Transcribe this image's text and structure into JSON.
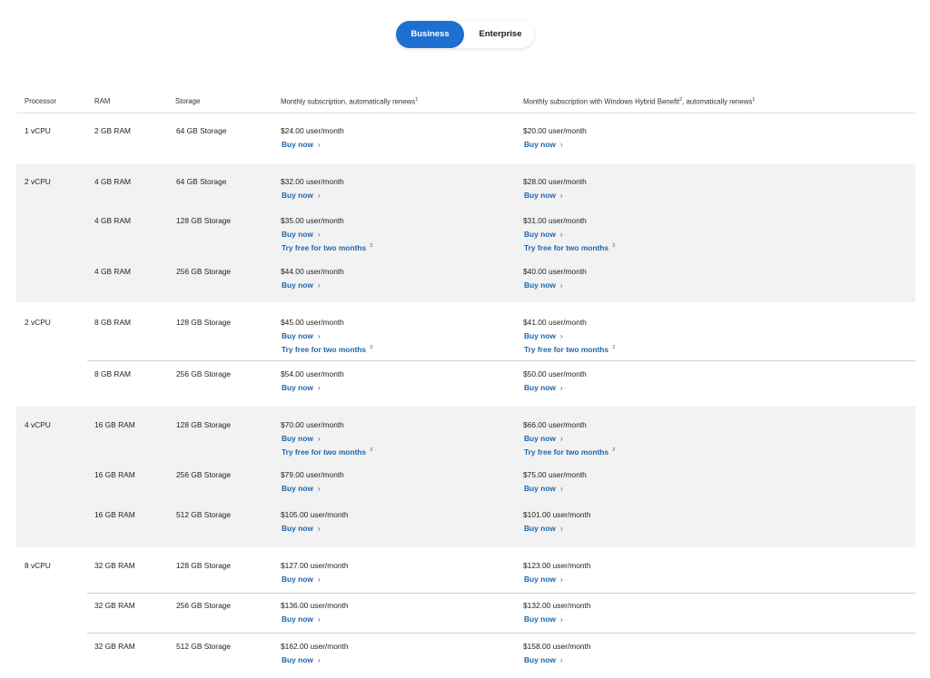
{
  "toggle": {
    "business": "Business",
    "enterprise": "Enterprise",
    "active_color": "#1f6fd0"
  },
  "table": {
    "headers": {
      "processor": "Processor",
      "ram": "RAM",
      "storage": "Storage",
      "monthly": "Monthly subscription, automatically renews",
      "monthly_sup": "1",
      "hybrid_pre": "Monthly subscription with ",
      "hybrid_bold": "Windows Hybrid Benefit",
      "hybrid_sup1": "2",
      "hybrid_post": ", automatically renews",
      "hybrid_sup2": "1"
    },
    "links": {
      "buy": "Buy now",
      "try": "Try free for two months",
      "try_sup": "3",
      "link_color": "#2266aa"
    },
    "rows": [
      {
        "processor": "1 vCPU",
        "ram": "2 GB RAM",
        "storage": "64 GB Storage",
        "price": "$24.00 user/month",
        "hybrid": "$20.00 user/month",
        "try": false
      },
      {
        "processor": "2 vCPU",
        "ram": "4 GB RAM",
        "storage": "64 GB Storage",
        "price": "$32.00 user/month",
        "hybrid": "$28.00 user/month",
        "try": false
      },
      {
        "processor": "",
        "ram": "4 GB RAM",
        "storage": "128 GB Storage",
        "price": "$35.00 user/month",
        "hybrid": "$31.00 user/month",
        "try": true
      },
      {
        "processor": "",
        "ram": "4 GB RAM",
        "storage": "256 GB Storage",
        "price": "$44.00 user/month",
        "hybrid": "$40.00 user/month",
        "try": false
      },
      {
        "processor": "2 vCPU",
        "ram": "8 GB RAM",
        "storage": "128 GB Storage",
        "price": "$45.00 user/month",
        "hybrid": "$41.00 user/month",
        "try": true
      },
      {
        "processor": "",
        "ram": "8 GB RAM",
        "storage": "256 GB Storage",
        "price": "$54.00 user/month",
        "hybrid": "$50.00 user/month",
        "try": false
      },
      {
        "processor": "4 vCPU",
        "ram": "16 GB RAM",
        "storage": "128 GB Storage",
        "price": "$70.00 user/month",
        "hybrid": "$66.00 user/month",
        "try": true
      },
      {
        "processor": "",
        "ram": "16 GB RAM",
        "storage": "256 GB Storage",
        "price": "$79.00 user/month",
        "hybrid": "$75.00 user/month",
        "try": false
      },
      {
        "processor": "",
        "ram": "16 GB RAM",
        "storage": "512 GB Storage",
        "price": "$105.00 user/month",
        "hybrid": "$101.00 user/month",
        "try": false
      },
      {
        "processor": "8 vCPU",
        "ram": "32 GB RAM",
        "storage": "128 GB Storage",
        "price": "$127.00 user/month",
        "hybrid": "$123.00 user/month",
        "try": false
      },
      {
        "processor": "",
        "ram": "32 GB RAM",
        "storage": "256 GB Storage",
        "price": "$136.00 user/month",
        "hybrid": "$132.00 user/month",
        "try": false
      },
      {
        "processor": "",
        "ram": "32 GB RAM",
        "storage": "512 GB Storage",
        "price": "$162.00 user/month",
        "hybrid": "$158.00 user/month",
        "try": false
      }
    ]
  }
}
